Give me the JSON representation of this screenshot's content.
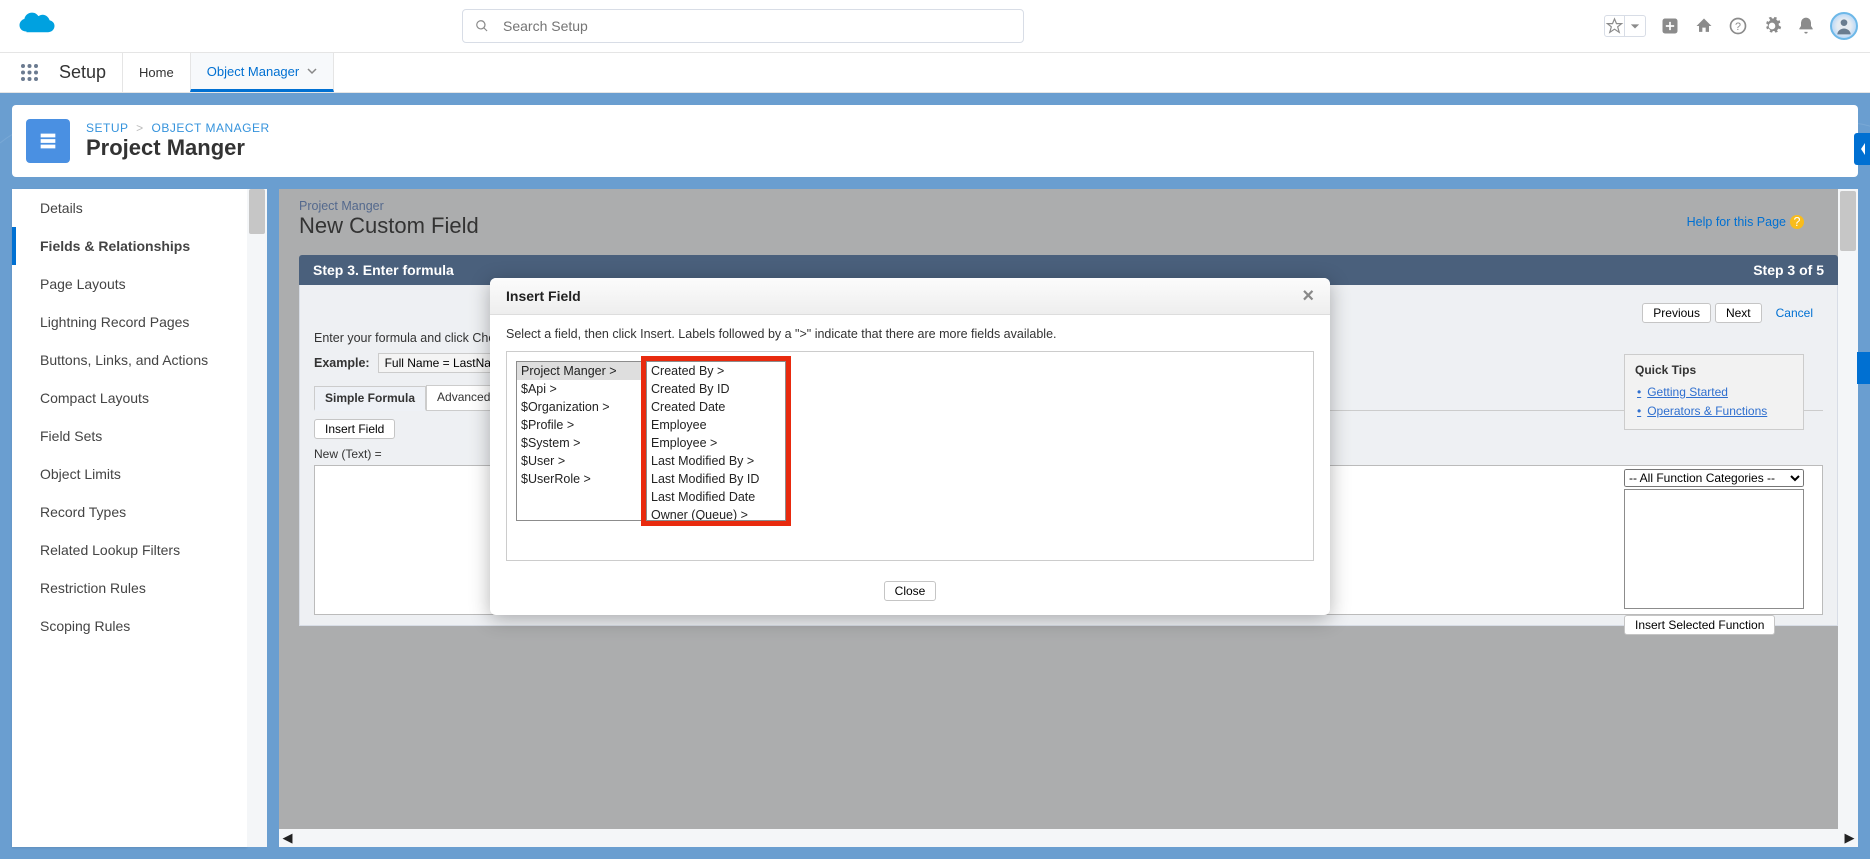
{
  "header": {
    "search_placeholder": "Search Setup"
  },
  "tabbar": {
    "app_name": "Setup",
    "tabs": [
      {
        "label": "Home",
        "active": false
      },
      {
        "label": "Object Manager",
        "active": true
      }
    ]
  },
  "breadcrumb": {
    "setup": "SETUP",
    "objmgr": "OBJECT MANAGER",
    "title": "Project Manger"
  },
  "sidebar": {
    "items": [
      "Details",
      "Fields & Relationships",
      "Page Layouts",
      "Lightning Record Pages",
      "Buttons, Links, and Actions",
      "Compact Layouts",
      "Field Sets",
      "Object Limits",
      "Record Types",
      "Related Lookup Filters",
      "Restriction Rules",
      "Scoping Rules"
    ],
    "active_index": 1
  },
  "content": {
    "subtitle": "Project Manger",
    "title": "New Custom Field",
    "help_label": "Help for this Page",
    "step_label": "Step 3. Enter formula",
    "step_indicator": "Step 3 of 5",
    "buttons": {
      "previous": "Previous",
      "next": "Next",
      "cancel": "Cancel"
    },
    "instr": "Enter your formula and click Check Syntax to check for errors.",
    "example_label": "Example:",
    "example_value": "Full Name = LastName & \", \" & FirstName",
    "tabs": {
      "simple": "Simple Formula",
      "advanced": "Advanced Formula"
    },
    "insert_field_btn": "Insert Field",
    "formula_label": "New (Text) =",
    "quicktips": {
      "title": "Quick Tips",
      "links": [
        "Getting Started",
        "Operators & Functions"
      ]
    },
    "func_dropdown": "-- All Function Categories --",
    "insert_fn_btn": "Insert Selected Function"
  },
  "modal": {
    "title": "Insert Field",
    "close_btn": "Close",
    "instr": "Select a field, then click Insert. Labels followed by a \">\" indicate that there are more fields available.",
    "col1": [
      "Project Manger >",
      "$Api >",
      "$Organization >",
      "$Profile >",
      "$System >",
      "$User >",
      "$UserRole >"
    ],
    "col1_selected": 0,
    "col2": [
      "Created By >",
      "Created By ID",
      "Created Date",
      "Employee",
      "Employee >",
      "Last Modified By >",
      "Last Modified By ID",
      "Last Modified Date",
      "Owner (Queue) >"
    ]
  }
}
